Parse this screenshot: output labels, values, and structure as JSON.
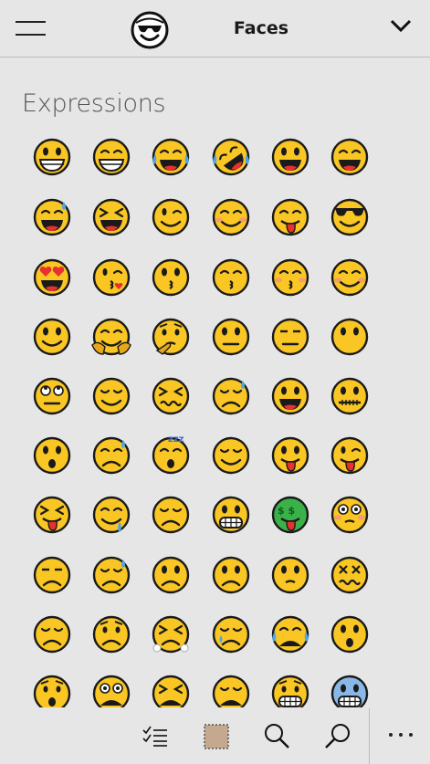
{
  "header": {
    "title": "Faces",
    "logo_icon": "sunglasses-face-logo-icon",
    "menu_icon": "hamburger-menu-icon",
    "dropdown_icon": "chevron-down-icon"
  },
  "section": {
    "title": "Expressions"
  },
  "colors": {
    "background": "#e6e6e6",
    "emoji_yellow": "#f9c623",
    "outline": "#1a1a1a",
    "divider": "#bdbdbd"
  },
  "emoji_rows": [
    [
      "grinning-face",
      "beaming-face",
      "face-with-tears-of-joy",
      "rolling-on-floor-laughing",
      "grinning-face-big-eyes",
      "grinning-face-smiling-eyes"
    ],
    [
      "grinning-face-with-sweat",
      "grinning-squinting-face",
      "winking-face",
      "smiling-face-blush",
      "face-savoring-food",
      "smiling-face-with-sunglasses"
    ],
    [
      "smiling-face-heart-eyes",
      "face-blowing-kiss",
      "kissing-face",
      "kissing-face-smiling-eyes",
      "kissing-face-closed-eyes",
      "smiling-face"
    ],
    [
      "slightly-smiling-face",
      "hugging-face",
      "thinking-face",
      "neutral-face",
      "expressionless-face",
      "face-without-mouth"
    ],
    [
      "face-with-rolling-eyes",
      "smirking-face",
      "persevering-face",
      "sad-relieved-face",
      "face-with-open-mouth",
      "zipper-mouth-face"
    ],
    [
      "hushed-face",
      "sleepy-face",
      "sleeping-face",
      "relieved-face",
      "face-with-tongue",
      "winking-face-with-tongue"
    ],
    [
      "squinting-face-with-tongue",
      "drooling-face",
      "unamused-face",
      "grimacing-face",
      "money-mouth-face",
      "flushed-face"
    ],
    [
      "unamused-side-face",
      "downcast-face-with-sweat",
      "frowning-face",
      "slightly-frowning-face",
      "confused-face",
      "confounded-face"
    ],
    [
      "disappointed-face",
      "worried-face",
      "face-with-steam",
      "crying-face",
      "loudly-crying-face",
      "face-with-open-mouth-small"
    ],
    [
      "frowning-open-mouth",
      "anguished-face",
      "tired-face",
      "weary-face",
      "grimacing-teeth-face",
      "cold-face"
    ]
  ],
  "toolbar": {
    "items": [
      {
        "name": "checklist-icon"
      },
      {
        "name": "stamp-icon"
      },
      {
        "name": "search-icon"
      },
      {
        "name": "search-alt-icon"
      }
    ],
    "more_icon": "more-dots-icon"
  }
}
